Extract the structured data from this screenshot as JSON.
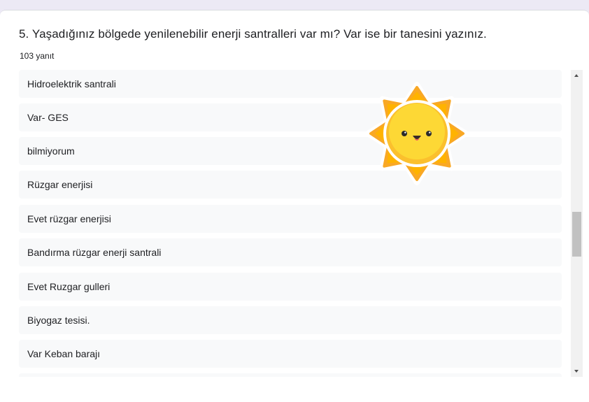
{
  "question": {
    "title": "5. Yaşadığınız bölgede yenilenebilir enerji santralleri var mı? Var ise bir tanesini yazınız.",
    "response_count": "103 yanıt"
  },
  "answers": [
    "Hidroelektrik santrali",
    "Var- GES",
    "bilmiyorum",
    "Rüzgar enerjisi",
    "Evet rüzgar enerjisi",
    "Bandırma rüzgar enerji santrali",
    "Evet Ruzgar gulleri",
    "Biyogaz tesisi.",
    "Var Keban barajı",
    ""
  ],
  "sticker": {
    "icon": "sun-face-icon"
  },
  "colors": {
    "page_background": "#ece9f5",
    "card_background": "#ffffff",
    "answer_background": "#f8f9fa",
    "text": "#202124",
    "sun_outer": "#f9a825",
    "sun_inner": "#fdd835"
  }
}
